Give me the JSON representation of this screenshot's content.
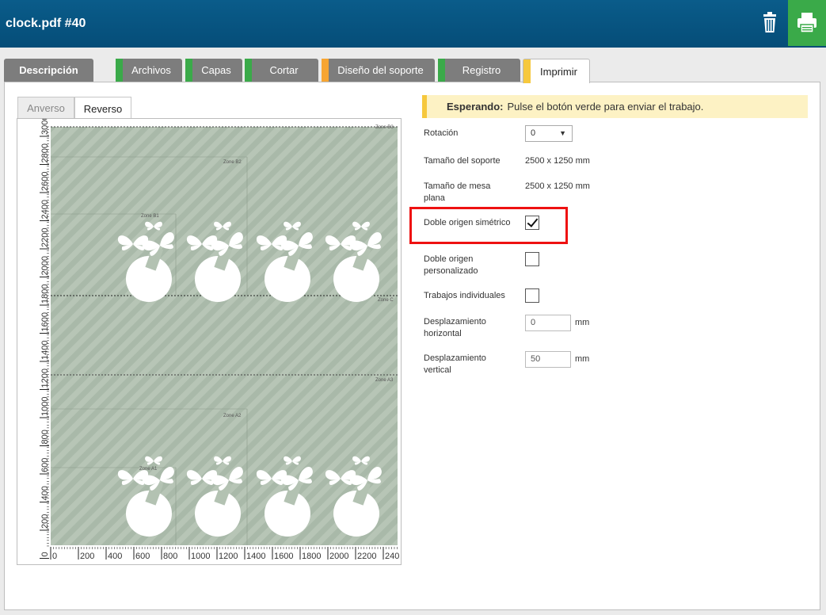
{
  "window": {
    "title": "clock.pdf #40"
  },
  "icons": {
    "delete": "trash-icon",
    "print": "printer-icon"
  },
  "colors": {
    "header": "#0a5c8a",
    "print_button": "#3aaa49",
    "tab_inactive": "#7d7d7d",
    "stripe_green": "#3aaa49",
    "stripe_orange": "#f7a532",
    "stripe_yellow": "#f6c83d",
    "highlight": "#e11111"
  },
  "tabs": [
    {
      "label": "Descripción"
    },
    {
      "label": "Archivos"
    },
    {
      "label": "Capas"
    },
    {
      "label": "Cortar"
    },
    {
      "label": "Diseño del soporte"
    },
    {
      "label": "Registro"
    },
    {
      "label": "Imprimir"
    }
  ],
  "preview_tabs": [
    {
      "label": "Anverso"
    },
    {
      "label": "Reverso"
    }
  ],
  "preview": {
    "zones": [
      "Zone B3",
      "Zone B2",
      "Zone B1",
      "Zone C",
      "Zone A3",
      "Zone A2",
      "Zone A1"
    ],
    "ruler_x": [
      "0",
      "200",
      "400",
      "600",
      "800",
      "1000",
      "1200",
      "1400",
      "1600",
      "1800",
      "2000",
      "2200",
      "240"
    ],
    "ruler_y": [
      "3000",
      "2800",
      "2600",
      "2400",
      "2200",
      "2000",
      "1800",
      "1600",
      "1400",
      "1200",
      "1000",
      "800",
      "600",
      "400",
      "200",
      "0"
    ]
  },
  "status": {
    "label": "Esperando:",
    "message": "Pulse el botón verde para enviar el trabajo."
  },
  "fields": {
    "rotation": {
      "label": "Rotación",
      "value": "0"
    },
    "media_size": {
      "label": "Tamaño del soporte",
      "value": "2500 x 1250 mm"
    },
    "table_size": {
      "label": "Tamaño de mesa plana",
      "value": "2500 x 1250 mm"
    },
    "dual_origin_symmetric": {
      "label": "Doble origen simétrico",
      "checked": true
    },
    "dual_origin_custom": {
      "label": "Doble origen personalizado",
      "checked": false
    },
    "individual_jobs": {
      "label": "Trabajos individuales",
      "checked": false
    },
    "offset_h": {
      "label": "Desplazamiento horizontal",
      "value": "0",
      "unit": "mm"
    },
    "offset_v": {
      "label": "Desplazamiento vertical",
      "value": "50",
      "unit": "mm"
    }
  }
}
